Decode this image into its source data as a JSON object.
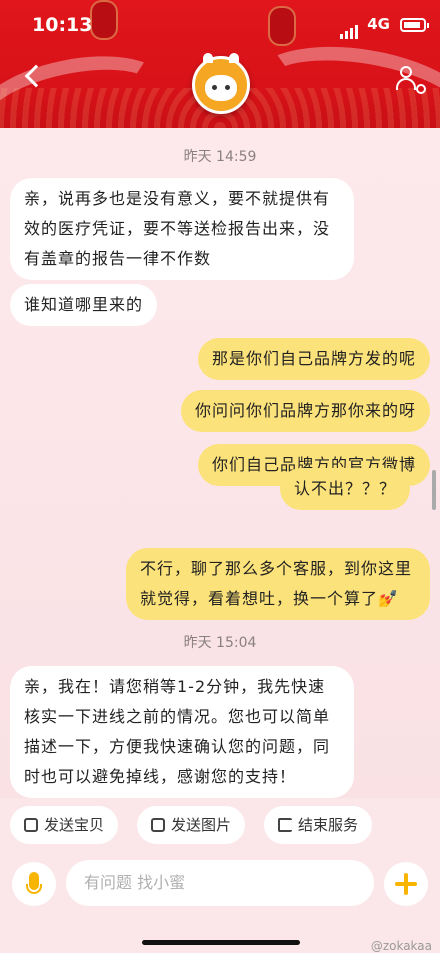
{
  "status": {
    "time": "10:13",
    "network": "4G"
  },
  "header": {
    "back_icon": "chevron-left-icon",
    "avatar": "bull-mascot-icon",
    "settings_icon": "user-settings-icon"
  },
  "messages": [
    {
      "type": "timestamp",
      "text": "昨天 14:59"
    },
    {
      "type": "in",
      "text": "亲，说再多也是没有意义，要不就提供有效的医疗凭证，要不等送检报告出来，没有盖章的报告一律不作数"
    },
    {
      "type": "in",
      "text": "谁知道哪里来的"
    },
    {
      "type": "out",
      "text": "那是你们自己品牌方发的呢"
    },
    {
      "type": "out",
      "text": "你问问你们品牌方那你来的呀"
    },
    {
      "type": "out",
      "text": "你们自己品牌方的官方微博"
    },
    {
      "type": "out",
      "text": "认不出？？？"
    },
    {
      "type": "out",
      "text": "不行，聊了那么多个客服，到你这里就觉得，看着想吐，换一个算了💅"
    },
    {
      "type": "timestamp",
      "text": "昨天 15:04"
    },
    {
      "type": "in",
      "text": "亲，我在！请您稍等1-2分钟，我先快速核实一下进线之前的情况。您也可以简单描述一下，方便我快速确认您的问题，同时也可以避免掉线，感谢您的支持！"
    }
  ],
  "quick_actions": [
    {
      "label": "发送宝贝",
      "icon": "product-icon"
    },
    {
      "label": "发送图片",
      "icon": "image-icon"
    },
    {
      "label": "结束服务",
      "icon": "exit-icon"
    }
  ],
  "input": {
    "placeholder": "有问题 找小蜜"
  },
  "watermark": "@zokakaa"
}
